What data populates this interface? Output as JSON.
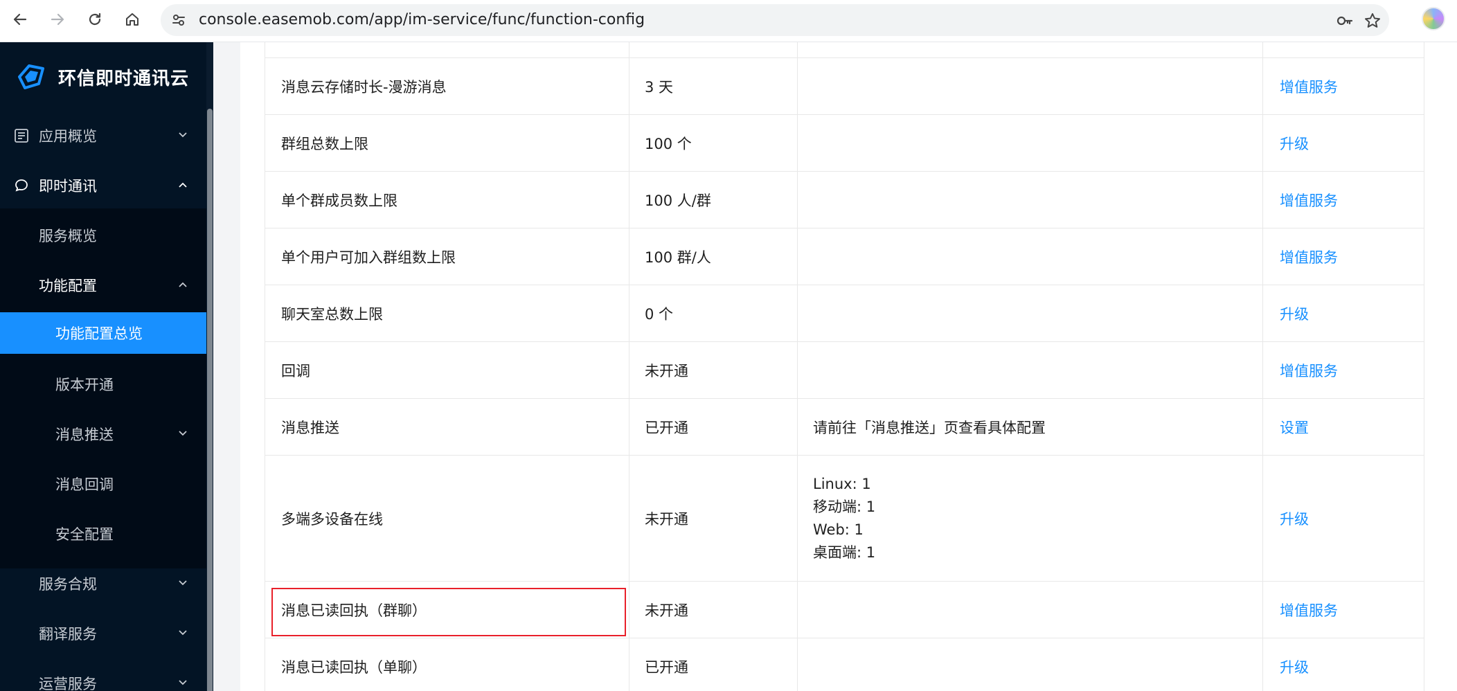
{
  "browser": {
    "url": "console.easemob.com/app/im-service/func/function-config",
    "icons": [
      "back-arrow-icon",
      "forward-arrow-icon",
      "reload-icon",
      "home-icon",
      "site-settings-icon",
      "password-key-icon",
      "bookmark-star-icon",
      "profile-avatar"
    ]
  },
  "sidebar": {
    "brand": "环信即时通讯云",
    "items": [
      {
        "label": "应用概览",
        "icon": "dashboard-icon",
        "expandable": true,
        "expanded": false
      },
      {
        "label": "即时通讯",
        "icon": "chat-icon",
        "expandable": true,
        "expanded": true
      },
      {
        "label": "服务概览"
      },
      {
        "label": "功能配置",
        "expandable": true,
        "expanded": true
      },
      {
        "label": "功能配置总览",
        "active": true
      },
      {
        "label": "版本开通"
      },
      {
        "label": "消息推送",
        "expandable": true,
        "expanded": false
      },
      {
        "label": "消息回调"
      },
      {
        "label": "安全配置"
      },
      {
        "label": "服务合规",
        "expandable": true,
        "expanded": false
      },
      {
        "label": "翻译服务",
        "expandable": true,
        "expanded": false
      },
      {
        "label": "运营服务",
        "expandable": true,
        "expanded": false
      }
    ]
  },
  "table": {
    "rows": [
      {
        "feature": "",
        "value": "",
        "note": "",
        "action": ""
      },
      {
        "feature": "消息云存储时长-漫游消息",
        "value": "3 天",
        "note": "",
        "action": "增值服务"
      },
      {
        "feature": "群组总数上限",
        "value": "100 个",
        "note": "",
        "action": "升级"
      },
      {
        "feature": "单个群成员数上限",
        "value": "100 人/群",
        "note": "",
        "action": "增值服务"
      },
      {
        "feature": "单个用户可加入群组数上限",
        "value": "100 群/人",
        "note": "",
        "action": "增值服务"
      },
      {
        "feature": "聊天室总数上限",
        "value": "0 个",
        "note": "",
        "action": "升级"
      },
      {
        "feature": "回调",
        "value": "未开通",
        "note": "",
        "action": "增值服务"
      },
      {
        "feature": "消息推送",
        "value": "已开通",
        "note": "请前往「消息推送」页查看具体配置",
        "action": "设置"
      },
      {
        "feature": "多端多设备在线",
        "value": "未开通",
        "note_lines": [
          "Linux: 1",
          "移动端: 1",
          "Web: 1",
          "桌面端: 1"
        ],
        "action": "升级"
      },
      {
        "feature": "消息已读回执（群聊）",
        "value": "未开通",
        "note": "",
        "action": "增值服务",
        "highlighted": true
      },
      {
        "feature": "消息已读回执（单聊）",
        "value": "已开通",
        "note": "",
        "action": "升级"
      }
    ]
  },
  "colors": {
    "sidebar_bg": "#031425",
    "active_item": "#1890ff",
    "link": "#1890ff",
    "highlight_border": "#e8202a"
  }
}
